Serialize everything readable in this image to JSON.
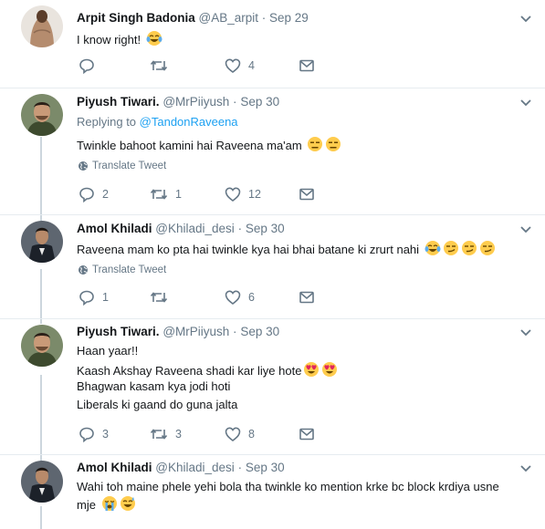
{
  "tweets": [
    {
      "name": "Arpit Singh Badonia",
      "handle": "@AB_arpit",
      "dot": "·",
      "date": "Sep 29",
      "lines": [
        "I know right!"
      ],
      "emojis": [
        "tears-of-joy"
      ],
      "replies": "",
      "retweets": "",
      "likes": "4"
    },
    {
      "name": "Piyush Tiwari.",
      "handle": "@MrPiiyush",
      "dot": "·",
      "date": "Sep 30",
      "replying_prefix": "Replying to ",
      "replying_handle": "@TandonRaveena",
      "lines": [
        "Twinkle bahoot kamini hai Raveena ma'am"
      ],
      "emojis": [
        "expressionless",
        "expressionless"
      ],
      "translate": "Translate Tweet",
      "replies": "2",
      "retweets": "1",
      "likes": "12"
    },
    {
      "name": "Amol Khiladi",
      "handle": "@Khiladi_desi",
      "dot": "·",
      "date": "Sep 30",
      "lines": [
        "Raveena mam ko pta hai twinkle kya hai bhai batane ki zrurt nahi"
      ],
      "emojis": [
        "tears-of-joy",
        "smirk",
        "smirk",
        "smirk"
      ],
      "translate": "Translate Tweet",
      "replies": "1",
      "retweets": "",
      "likes": "6"
    },
    {
      "name": "Piyush Tiwari.",
      "handle": "@MrPiiyush",
      "dot": "·",
      "date": "Sep 30",
      "lines": [
        "Haan yaar!!",
        "Kaash Akshay Raveena shadi kar liye hote",
        "Bhagwan kasam kya jodi hoti",
        "Liberals ki gaand do guna jalta"
      ],
      "emojis": [
        "heart-eyes",
        "heart-eyes"
      ],
      "replies": "3",
      "retweets": "3",
      "likes": "8"
    },
    {
      "name": "Amol Khiladi",
      "handle": "@Khiladi_desi",
      "dot": "·",
      "date": "Sep 30",
      "lines": [
        "Wahi toh maine phele yehi bola tha twinkle ko mention krke bc block krdiya usne",
        "mje"
      ],
      "emojis": [
        "loudly-crying",
        "sweat-smile"
      ]
    }
  ],
  "colors": {
    "text": "#14171a",
    "secondary": "#657786",
    "link": "#1da1f2",
    "border": "#e6ecf0",
    "thread": "#ccd6dd"
  }
}
